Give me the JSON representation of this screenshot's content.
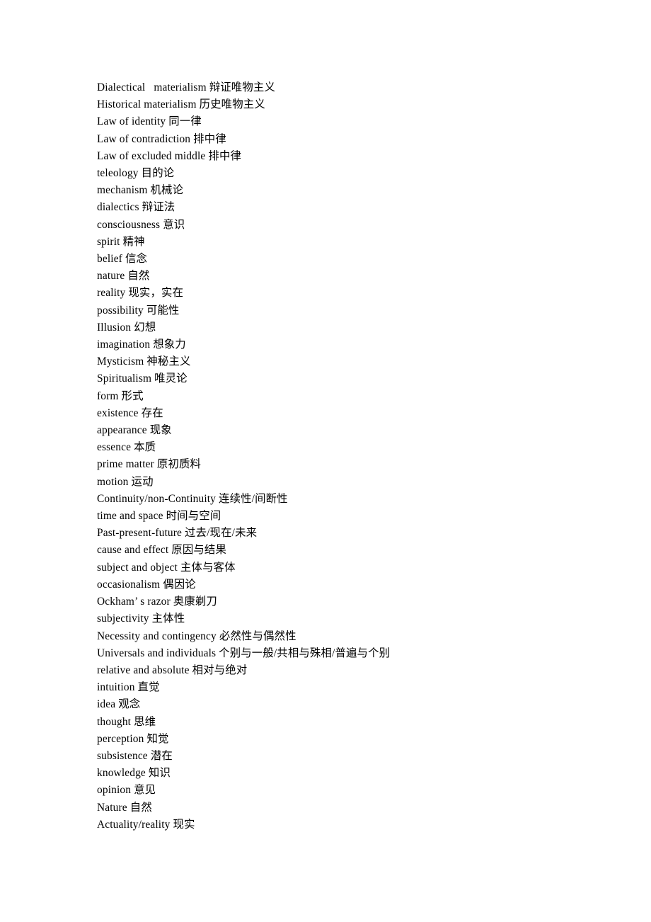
{
  "document": {
    "kind": "text-document",
    "page_background": "#ffffff",
    "text_color": "#000000",
    "glossary_title": "",
    "entries": [
      {
        "term": "Dialectical   materialism",
        "translation": "辩证唯物主义",
        "line": "Dialectical   materialism 辩证唯物主义"
      },
      {
        "term": "Historical materialism",
        "translation": "历史唯物主义",
        "line": "Historical materialism 历史唯物主义"
      },
      {
        "term": "Law of identity",
        "translation": "同一律",
        "line": "Law of identity 同一律"
      },
      {
        "term": "Law of contradiction",
        "translation": "排中律",
        "line": "Law of contradiction 排中律"
      },
      {
        "term": "Law of excluded middle",
        "translation": "排中律",
        "line": "Law of excluded middle 排中律"
      },
      {
        "term": "teleology",
        "translation": "目的论",
        "line": "teleology 目的论"
      },
      {
        "term": "mechanism",
        "translation": "机械论",
        "line": "mechanism 机械论"
      },
      {
        "term": "dialectics",
        "translation": "辩证法",
        "line": "dialectics 辩证法"
      },
      {
        "term": "consciousness",
        "translation": "意识",
        "line": "consciousness 意识"
      },
      {
        "term": "spirit",
        "translation": "精神",
        "line": "spirit 精神"
      },
      {
        "term": "belief",
        "translation": "信念",
        "line": "belief 信念"
      },
      {
        "term": "nature",
        "translation": "自然",
        "line": "nature 自然"
      },
      {
        "term": "reality",
        "translation": "现实，实在",
        "line": "reality 现实，实在"
      },
      {
        "term": "possibility",
        "translation": "可能性",
        "line": "possibility 可能性"
      },
      {
        "term": "Illusion",
        "translation": "幻想",
        "line": "Illusion 幻想"
      },
      {
        "term": "imagination",
        "translation": "想象力",
        "line": "imagination 想象力"
      },
      {
        "term": "Mysticism",
        "translation": "神秘主义",
        "line": "Mysticism 神秘主义"
      },
      {
        "term": "Spiritualism",
        "translation": "唯灵论",
        "line": "Spiritualism 唯灵论"
      },
      {
        "term": "form",
        "translation": "形式",
        "line": "form 形式"
      },
      {
        "term": "existence",
        "translation": "存在",
        "line": "existence 存在"
      },
      {
        "term": "appearance",
        "translation": "现象",
        "line": "appearance 现象"
      },
      {
        "term": "essence",
        "translation": "本质",
        "line": "essence 本质"
      },
      {
        "term": "prime matter",
        "translation": "原初质料",
        "line": "prime matter 原初质料"
      },
      {
        "term": "motion",
        "translation": "运动",
        "line": "motion 运动"
      },
      {
        "term": "Continuity/non-Continuity",
        "translation": "连续性/间断性",
        "line": "Continuity/non-Continuity 连续性/间断性"
      },
      {
        "term": "time and space",
        "translation": "时间与空间",
        "line": "time and space 时间与空间"
      },
      {
        "term": "Past-present-future",
        "translation": "过去/现在/未来",
        "line": "Past-present-future 过去/现在/未来"
      },
      {
        "term": "cause and effect",
        "translation": "原因与结果",
        "line": "cause and effect 原因与结果"
      },
      {
        "term": "subject and object",
        "translation": "主体与客体",
        "line": "subject and object 主体与客体"
      },
      {
        "term": "occasionalism",
        "translation": "偶因论",
        "line": "occasionalism 偶因论"
      },
      {
        "term": "Ockham’ s razor",
        "translation": "奥康剃刀",
        "line": "Ockham’ s razor 奥康剃刀"
      },
      {
        "term": "subjectivity",
        "translation": "主体性",
        "line": "subjectivity 主体性"
      },
      {
        "term": "Necessity and contingency",
        "translation": "必然性与偶然性",
        "line": "Necessity and contingency 必然性与偶然性"
      },
      {
        "term": "Universals and individuals",
        "translation": "个别与一般/共相与殊相/普遍与个别",
        "line": "Universals and individuals 个别与一般/共相与殊相/普遍与个别"
      },
      {
        "term": "relative and absolute",
        "translation": "相对与绝对",
        "line": "relative and absolute 相对与绝对"
      },
      {
        "term": "intuition",
        "translation": "直觉",
        "line": "intuition 直觉"
      },
      {
        "term": "idea",
        "translation": "观念",
        "line": "idea 观念"
      },
      {
        "term": "thought",
        "translation": "思维",
        "line": "thought 思维"
      },
      {
        "term": "perception",
        "translation": "知觉",
        "line": "perception 知觉"
      },
      {
        "term": "subsistence",
        "translation": "潜在",
        "line": "subsistence 潜在"
      },
      {
        "term": "knowledge",
        "translation": "知识",
        "line": "knowledge 知识"
      },
      {
        "term": "opinion",
        "translation": "意见",
        "line": "opinion 意见"
      },
      {
        "term": "Nature",
        "translation": "自然",
        "line": "Nature 自然"
      },
      {
        "term": "Actuality/reality",
        "translation": "现实",
        "line": "Actuality/reality 现实"
      }
    ]
  }
}
